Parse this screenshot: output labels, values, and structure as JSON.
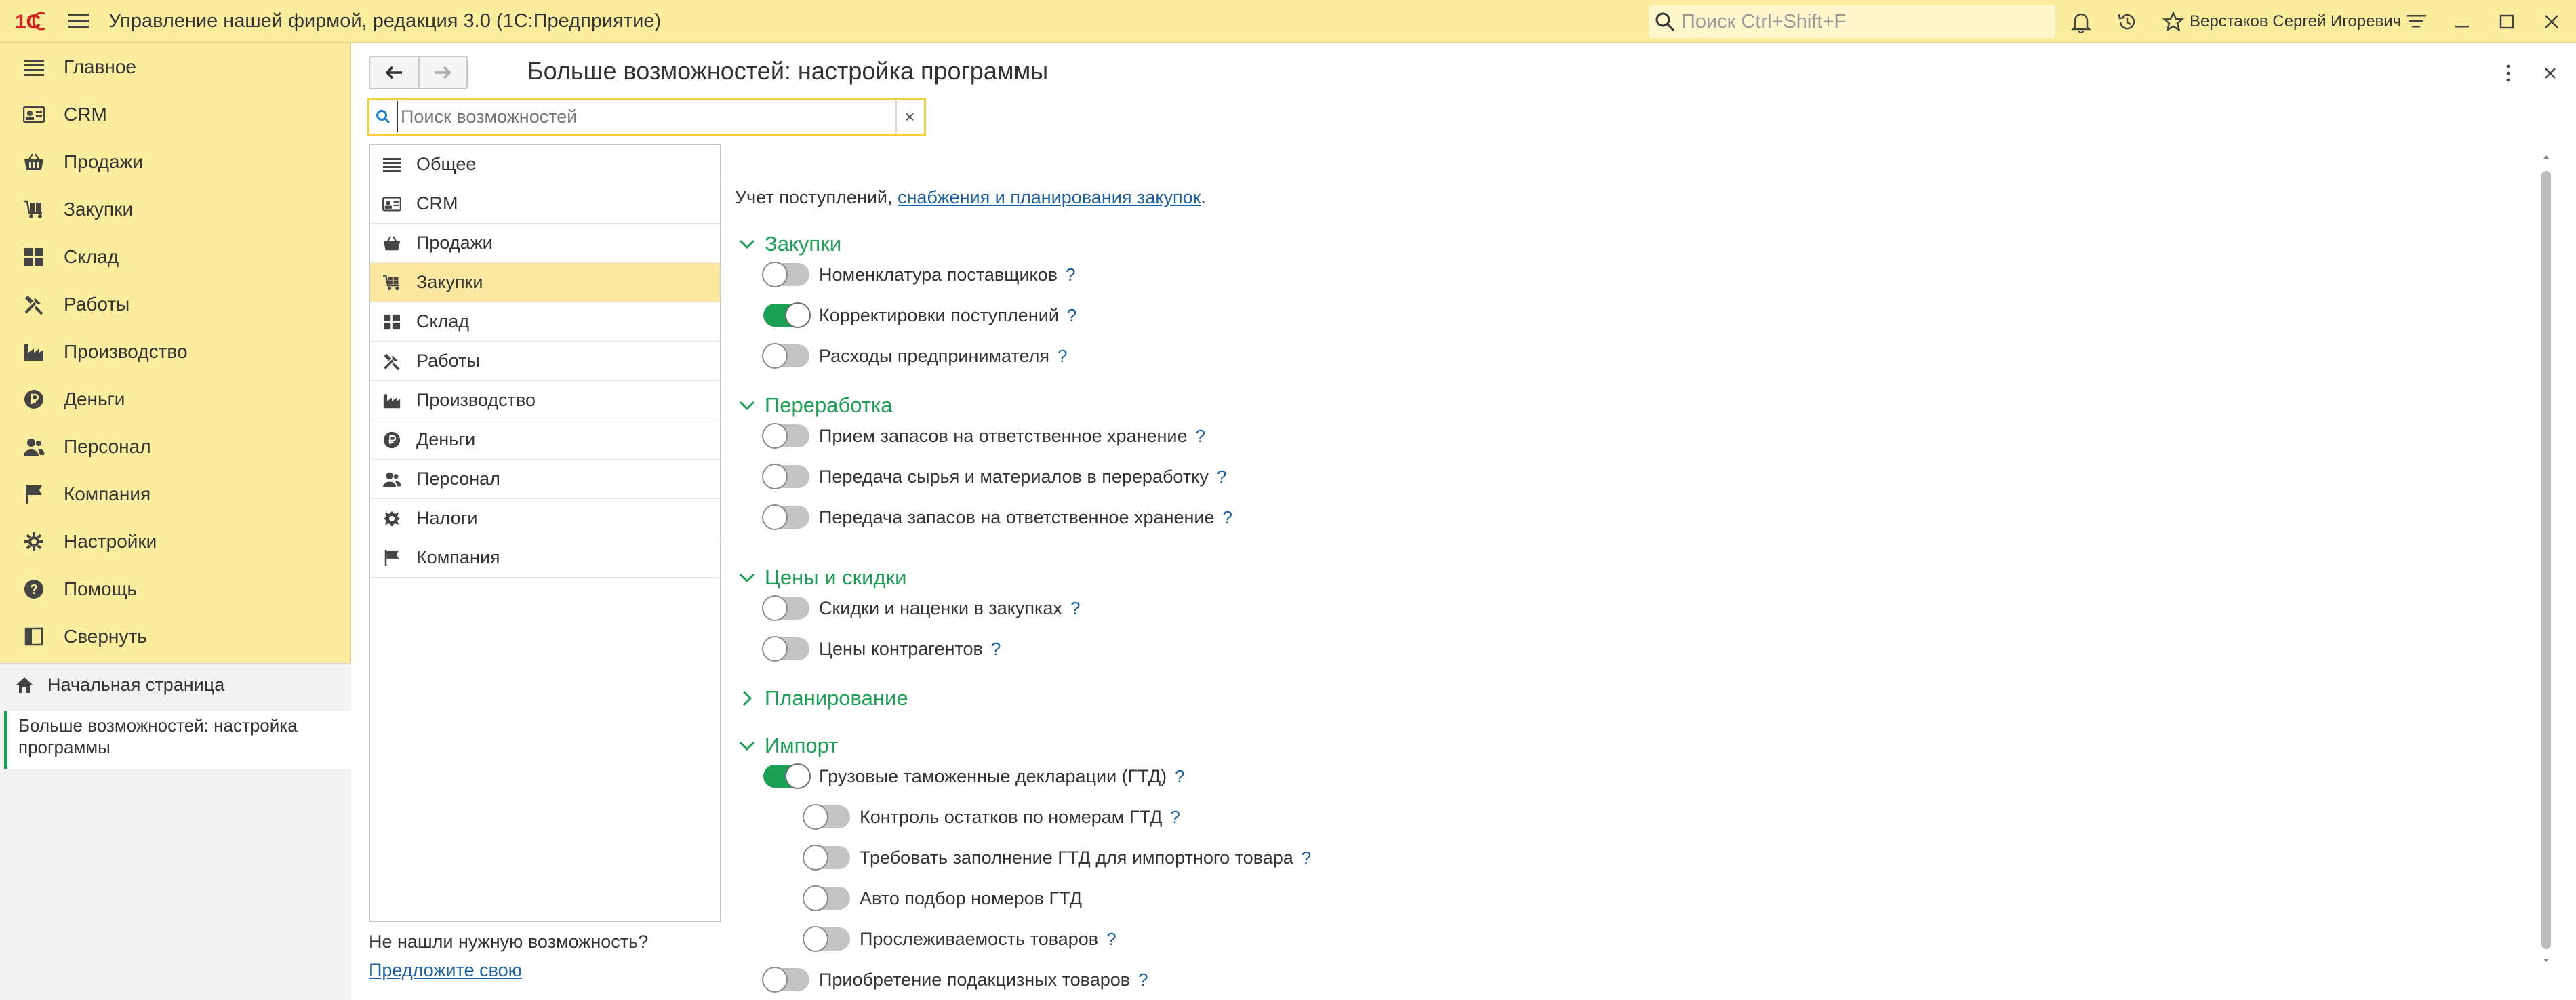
{
  "titlebar": {
    "logo_text": "1С",
    "title": "Управление нашей фирмой, редакция 3.0  (1С:Предприятие)",
    "search_placeholder": "Поиск Ctrl+Shift+F",
    "user": "Верстаков Сергей Игоревич"
  },
  "sidebar": {
    "items": [
      {
        "label": "Главное",
        "icon": "list-icon"
      },
      {
        "label": "CRM",
        "icon": "crm-card-icon"
      },
      {
        "label": "Продажи",
        "icon": "basket-icon"
      },
      {
        "label": "Закупки",
        "icon": "cart-icon"
      },
      {
        "label": "Склад",
        "icon": "warehouse-icon"
      },
      {
        "label": "Работы",
        "icon": "tools-icon"
      },
      {
        "label": "Производство",
        "icon": "factory-icon"
      },
      {
        "label": "Деньги",
        "icon": "ruble-icon"
      },
      {
        "label": "Персонал",
        "icon": "people-icon"
      },
      {
        "label": "Компания",
        "icon": "flag-icon"
      },
      {
        "label": "Настройки",
        "icon": "gear-icon"
      },
      {
        "label": "Помощь",
        "icon": "help-icon"
      },
      {
        "label": "Свернуть",
        "icon": "collapse-icon"
      }
    ],
    "home": "Начальная страница",
    "open_doc": "Больше возможностей: настройка программы"
  },
  "form": {
    "title": "Больше возможностей: настройка программы",
    "search_placeholder": "Поиск возможностей",
    "clear": "×",
    "sections": [
      {
        "label": "Общее",
        "active": false
      },
      {
        "label": "CRM",
        "active": false
      },
      {
        "label": "Продажи",
        "active": false
      },
      {
        "label": "Закупки",
        "active": true
      },
      {
        "label": "Склад",
        "active": false
      },
      {
        "label": "Работы",
        "active": false
      },
      {
        "label": "Производство",
        "active": false
      },
      {
        "label": "Деньги",
        "active": false
      },
      {
        "label": "Персонал",
        "active": false
      },
      {
        "label": "Налоги",
        "active": false
      },
      {
        "label": "Компания",
        "active": false
      }
    ],
    "not_found": "Не нашли нужную возможность?",
    "suggest": "Предложите свою",
    "intro_text": "Учет поступлений, ",
    "intro_link": "снабжения и планирования закупок",
    "intro_tail": "."
  },
  "groups": {
    "zakupki": {
      "title": "Закупки",
      "options": [
        {
          "label": "Номенклатура поставщиков",
          "on": false,
          "help": "?"
        },
        {
          "label": "Корректировки поступлений",
          "on": true,
          "help": "?"
        },
        {
          "label": "Расходы предпринимателя",
          "on": false,
          "help": "?"
        }
      ]
    },
    "pererabotka": {
      "title": "Переработка",
      "options": [
        {
          "label": "Прием запасов на ответственное хранение",
          "on": false,
          "help": "?"
        },
        {
          "label": "Передача сырья и материалов в переработку",
          "on": false,
          "help": "?"
        },
        {
          "label": "Передача запасов на ответственное хранение",
          "on": false,
          "help": "?"
        }
      ]
    },
    "ceny": {
      "title": "Цены и скидки",
      "options": [
        {
          "label": "Скидки и наценки в закупках",
          "on": false,
          "help": "?"
        },
        {
          "label": "Цены контрагентов",
          "on": false,
          "help": "?"
        }
      ]
    },
    "planirovanie": {
      "title": "Планирование"
    },
    "import": {
      "title": "Импорт",
      "options": [
        {
          "label": "Грузовые таможенные декларации (ГТД)",
          "on": true,
          "help": "?"
        },
        {
          "label": "Контроль остатков по номерам ГТД",
          "on": false,
          "help": "?"
        },
        {
          "label": "Требовать заполнение ГТД для импортного товара",
          "on": false,
          "help": "?"
        },
        {
          "label": "Авто подбор номеров ГТД",
          "on": false,
          "help": ""
        },
        {
          "label": "Прослеживаемость товаров",
          "on": false,
          "help": "?"
        },
        {
          "label": "Приобретение подакцизных товаров",
          "on": false,
          "help": "?"
        }
      ]
    }
  }
}
